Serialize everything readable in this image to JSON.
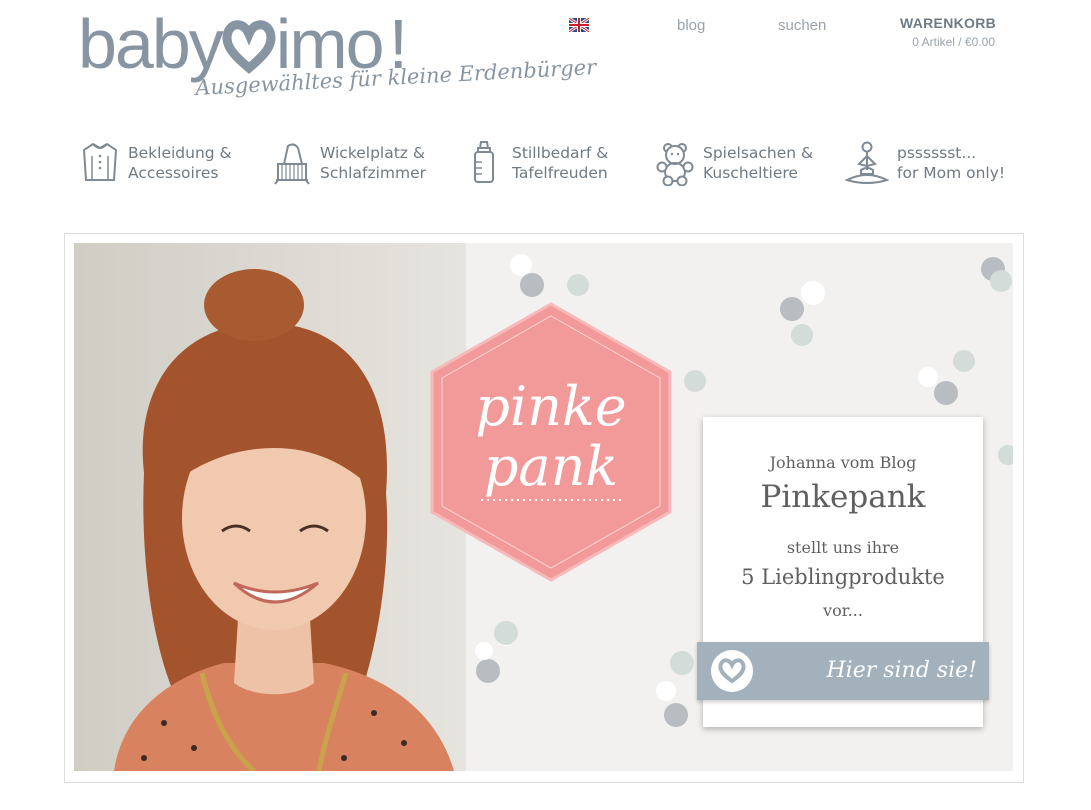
{
  "brand": {
    "logo_text_left": "baby",
    "logo_text_right": "imo",
    "logo_excl": "!",
    "tagline": "Ausgewähltes für kleine Erdenbürger"
  },
  "topnav": {
    "language_flag": "uk-flag-icon",
    "blog": "blog",
    "search": "suchen",
    "cart_title": "WARENKORB",
    "cart_info": "0 Artikel / €0.00"
  },
  "categories": [
    {
      "line1": "Bekleidung &",
      "line2": "Accessoires",
      "icon": "dress-icon"
    },
    {
      "line1": "Wickelplatz &",
      "line2": "Schlafzimmer",
      "icon": "crib-icon"
    },
    {
      "line1": "Stillbedarf &",
      "line2": "Tafelfreuden",
      "icon": "baby-bottle-icon"
    },
    {
      "line1": "Spielsachen &",
      "line2": "Kuscheltiere",
      "icon": "teddy-bear-icon"
    },
    {
      "line1": "psssssst...",
      "line2": "for Mom only!",
      "icon": "yoga-mom-icon"
    }
  ],
  "banner": {
    "hexagon_line1": "pinke",
    "hexagon_line2": "pank",
    "card_line1": "Johanna vom Blog",
    "card_line2": "Pinkepank",
    "card_line3": "stellt uns ihre",
    "card_line4": "5 Lieblingprodukte",
    "card_line5": "vor...",
    "cta_label": "Hier sind sie!",
    "cta_icon": "heart-icon"
  },
  "colors": {
    "brand_gray": "#8795a2",
    "text_gray": "#6f7a84",
    "cta_background": "#a3b1bc",
    "hexagon_pink": "#f08a8a"
  }
}
